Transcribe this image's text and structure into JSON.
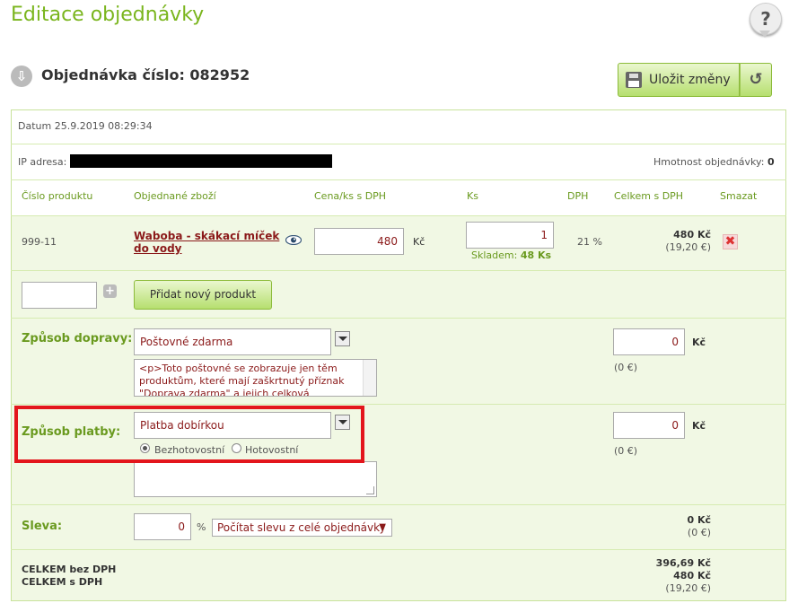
{
  "page": {
    "title": "Editace objednávky",
    "help_glyph": "?"
  },
  "order": {
    "heading": "Objednávka číslo: 082952"
  },
  "toolbar": {
    "save_label": "Uložit změny",
    "undo_glyph": "↺"
  },
  "info": {
    "date": "Datum 25.9.2019 08:29:34",
    "ip_label": "IP adresa:",
    "weight_label": "Hmotnost objednávky:",
    "weight_value": "0"
  },
  "table": {
    "headers": [
      "Číslo produktu",
      "Objednané zboží",
      "Cena/ks s DPH",
      "Ks",
      "DPH",
      "Celkem s DPH",
      "Smazat"
    ],
    "rows": [
      {
        "code": "999-11",
        "name_line1": "Waboba - skákací míček",
        "name_line2": "do vody",
        "price": "480",
        "currency": "Kč",
        "qty": "1",
        "stock_label": "Skladem:",
        "stock_value": "48 Ks",
        "vat": "21 %",
        "total": "480 Kč",
        "total_eur": "(19,20 €)"
      }
    ]
  },
  "add_product": {
    "code_value": "",
    "plus_glyph": "+",
    "button_label": "Přidat nový produkt"
  },
  "shipping": {
    "label": "Způsob dopravy:",
    "selected": "Poštovné zdarma",
    "note": "<p>Toto poštovné se zobrazuje jen těm produktům, které mají zaškrtnutý příznak \"Doprava zdarma\" a jejich celková",
    "price": "0",
    "currency": "Kč",
    "eur": "(0 €)"
  },
  "payment": {
    "label": "Způsob platby:",
    "selected": "Platba dobírkou",
    "radio_cashless": "Bezhotovostní",
    "radio_cash": "Hotovostní",
    "note": "",
    "price": "0",
    "currency": "Kč",
    "eur": "(0 €)"
  },
  "discount": {
    "label": "Sleva:",
    "value": "0",
    "unit": "%",
    "mode": "Počítat slevu z celé objednávky",
    "mode_arrow": "▼",
    "total": "0 Kč",
    "total_eur": "(0 €)"
  },
  "totals": {
    "without_vat_label": "CELKEM bez DPH",
    "with_vat_label": "CELKEM s DPH",
    "without_vat": "396,69 Kč",
    "with_vat": "480 Kč",
    "eur": "(19,20 €)"
  },
  "colors": {
    "accent": "#7ab51d",
    "highlight": "#e3161c",
    "row_bg": "#f1f8e4"
  }
}
